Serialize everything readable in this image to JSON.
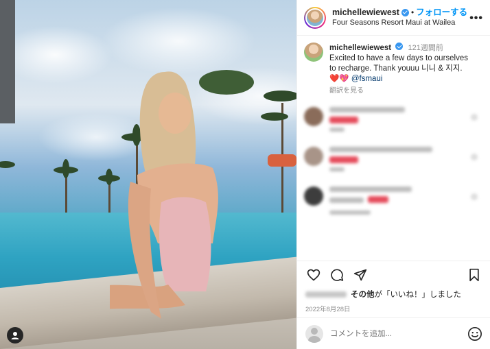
{
  "post": {
    "username": "michellewiewest",
    "follow_label": "フォローする",
    "separator": "•",
    "location": "Four Seasons Resort Maui at Wailea",
    "more_label": "•••"
  },
  "caption": {
    "username": "michellewiewest",
    "time": "121週間前",
    "text_line1": "Excited to have a few days to ourselves",
    "text_line2": "to recharge. Thank youuu 니니 & 지지.",
    "hearts": "❤️💖",
    "mention": "@fsmaui",
    "translate": "翻訳を見る"
  },
  "likes": {
    "liked_by": "その他",
    "liked_suffix": "が「いいね！」しました"
  },
  "date": "2022年8月28日",
  "comment_box": {
    "placeholder": "コメントを追加..."
  },
  "colors": {
    "accent": "#0095f6",
    "verified": "#3897f0",
    "heart": "#ed4956"
  },
  "icons": [
    "heart-icon",
    "comment-icon",
    "share-icon",
    "bookmark-icon",
    "emoji-icon",
    "user-tag-icon"
  ]
}
